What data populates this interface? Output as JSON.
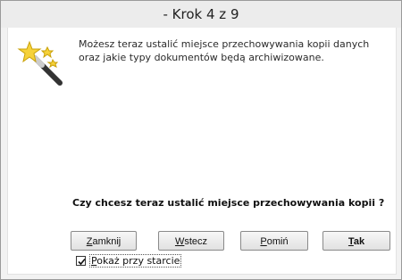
{
  "window": {
    "title": "- Krok 4 z 9"
  },
  "description": "Możesz teraz ustalić miejsce przechowywania kopii danych oraz jakie typy dokumentów będą archiwizowane.",
  "question": "Czy chcesz teraz ustalić miejsce przechowywania kopii ?",
  "buttons": {
    "close": {
      "mnemonic": "Z",
      "rest": "amknij"
    },
    "back": {
      "mnemonic": "W",
      "rest": "stecz"
    },
    "skip": {
      "mnemonic": "P",
      "rest": "omiń"
    },
    "yes": {
      "mnemonic": "T",
      "rest": "ak"
    }
  },
  "show_on_start": {
    "mnemonic": "P",
    "rest": "okaż przy starcie",
    "checked": true
  },
  "icons": [
    "magic-wand-icon",
    "checkmark-icon"
  ]
}
